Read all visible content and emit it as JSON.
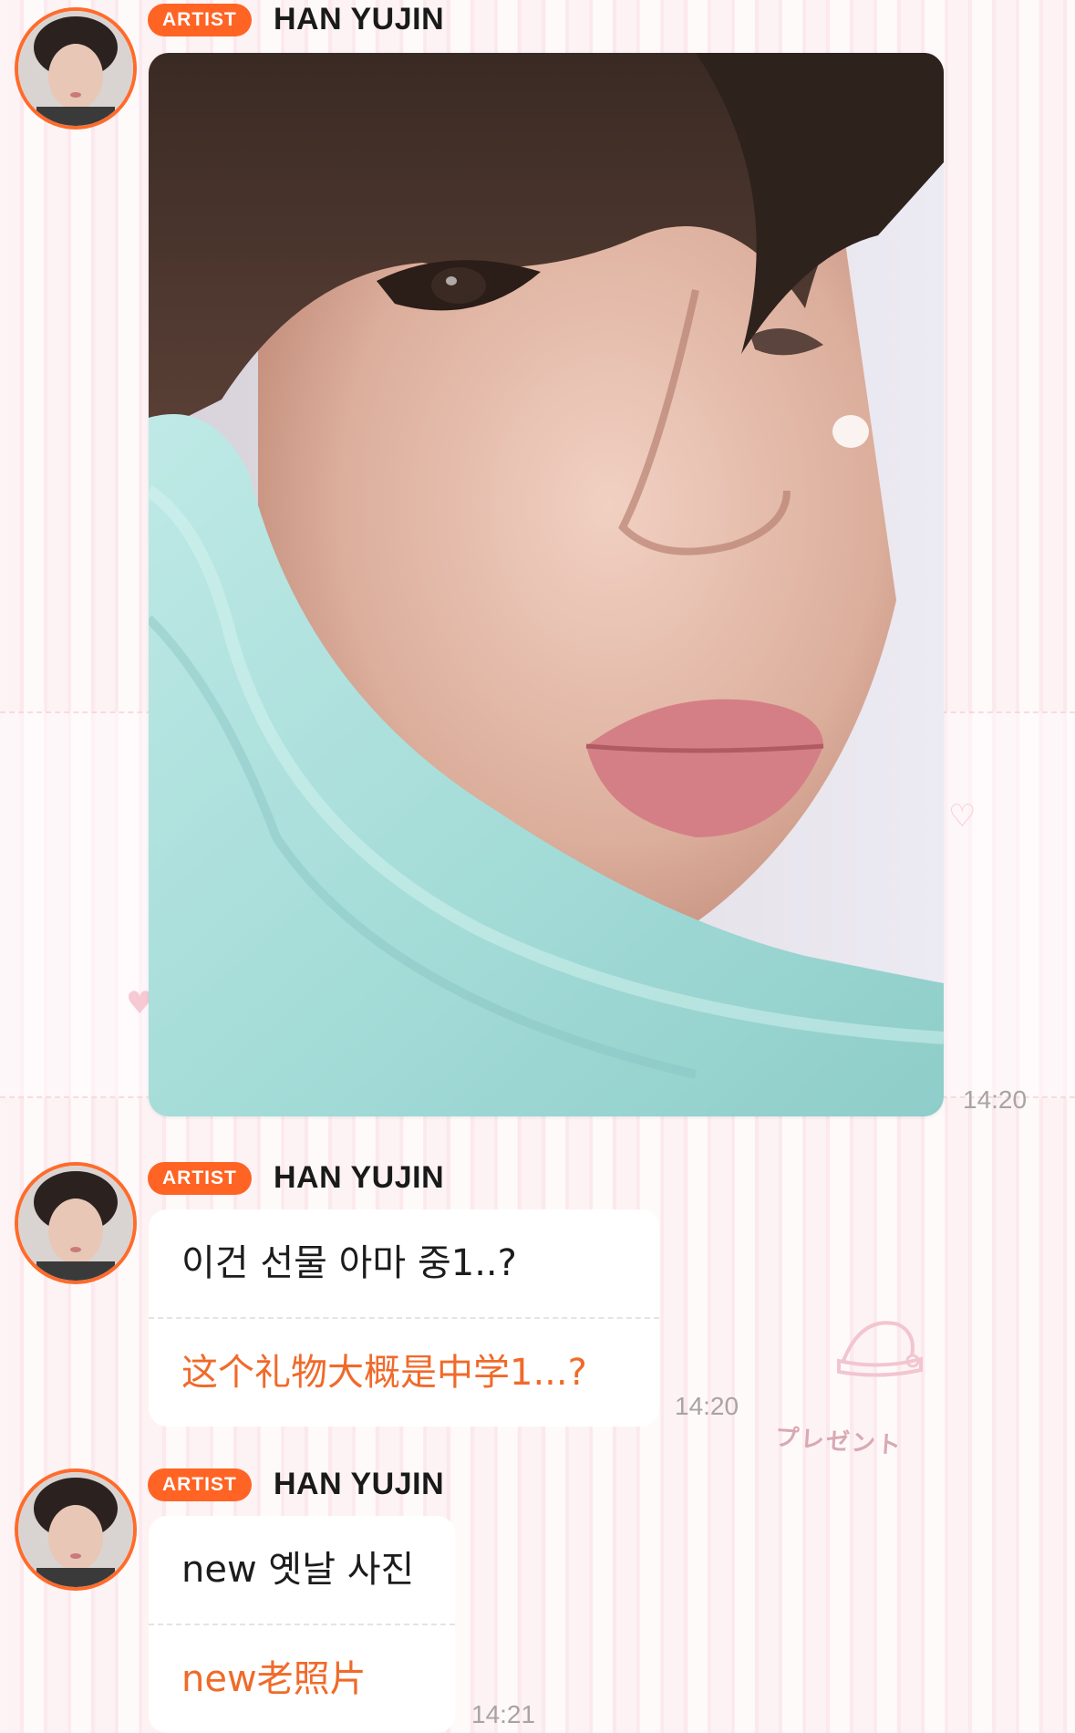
{
  "messages": [
    {
      "badge": "ARTIST",
      "sender": "HAN YUJIN",
      "type": "photo",
      "time": "14:20"
    },
    {
      "badge": "ARTIST",
      "sender": "HAN YUJIN",
      "type": "text",
      "original": "이건 선물 아마 중1..?",
      "translation": "这个礼物大概是中学1...?",
      "time": "14:20"
    },
    {
      "badge": "ARTIST",
      "sender": "HAN YUJIN",
      "type": "text",
      "original": "new 옛날 사진",
      "translation": "new老照片",
      "time": "14:21"
    }
  ],
  "decoration": {
    "present_text": "プレゼント"
  },
  "colors": {
    "accent": "#ff6424",
    "translation": "#f06a2a",
    "timestamp": "#a9a3a4",
    "background_stripe": "#fbe9ee"
  },
  "icons": {
    "avatar": "artist-avatar-icon",
    "decor_hat": "santa-hat-icon",
    "decor_heart": "heart-icon"
  }
}
